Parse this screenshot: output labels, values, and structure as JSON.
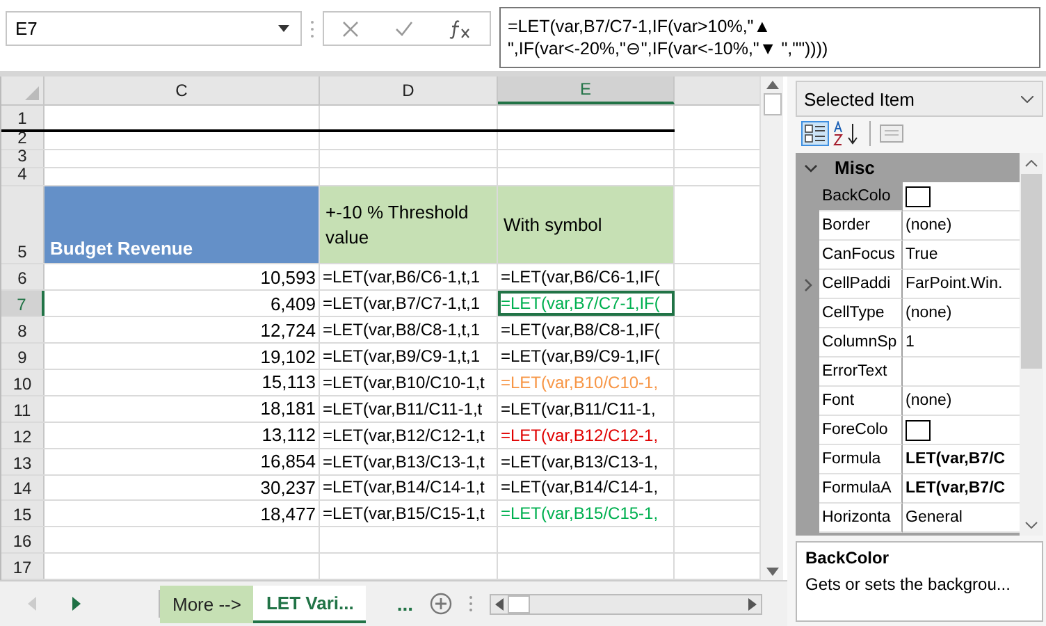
{
  "name_box": {
    "value": "E7"
  },
  "formula_bar": {
    "formula": "=LET(var,B7/C7-1,IF(var>10%,\"▲  \",IF(var<-20%,\"⊖\",IF(var<-10%,\"▼  \",\"\"))))"
  },
  "sheet": {
    "columns": [
      {
        "label": "C",
        "selected": false
      },
      {
        "label": "D",
        "selected": false
      },
      {
        "label": "E",
        "selected": true
      }
    ],
    "rows": [
      {
        "label": "1",
        "kind": "blank",
        "selected": false
      },
      {
        "label": "2",
        "kind": "spacer",
        "selected": false
      },
      {
        "label": "3",
        "kind": "spacer",
        "selected": false
      },
      {
        "label": "4",
        "kind": "spacer",
        "selected": false
      },
      {
        "label": "5",
        "kind": "header",
        "selected": false,
        "cells": [
          {
            "text": "Budget Revenue",
            "color": "#6490c8"
          },
          {
            "text": "+-10 % Threshold value",
            "color": "#c6e0b4"
          },
          {
            "text": "With symbol",
            "color": "#c6e0b4"
          }
        ]
      },
      {
        "label": "6",
        "kind": "data",
        "selected": false,
        "revenue": "10,593",
        "threshold": "=LET(var,B6/C6-1,t,1",
        "symbol": "=LET(var,B6/C6-1,IF(",
        "color": "#000000"
      },
      {
        "label": "7",
        "kind": "data",
        "selected": true,
        "revenue": "6,409",
        "threshold": "=LET(var,B7/C7-1,t,1",
        "symbol": "=LET(var,B7/C7-1,IF(",
        "color": "#00b050"
      },
      {
        "label": "8",
        "kind": "data",
        "selected": false,
        "revenue": "12,724",
        "threshold": "=LET(var,B8/C8-1,t,1",
        "symbol": "=LET(var,B8/C8-1,IF(",
        "color": "#000000"
      },
      {
        "label": "9",
        "kind": "data",
        "selected": false,
        "revenue": "19,102",
        "threshold": "=LET(var,B9/C9-1,t,1",
        "symbol": "=LET(var,B9/C9-1,IF(",
        "color": "#000000"
      },
      {
        "label": "10",
        "kind": "data",
        "selected": false,
        "revenue": "15,113",
        "threshold": "=LET(var,B10/C10-1,t",
        "symbol": "=LET(var,B10/C10-1,",
        "color": "#f79646"
      },
      {
        "label": "11",
        "kind": "data",
        "selected": false,
        "revenue": "18,181",
        "threshold": "=LET(var,B11/C11-1,t",
        "symbol": "=LET(var,B11/C11-1,",
        "color": "#000000"
      },
      {
        "label": "12",
        "kind": "data",
        "selected": false,
        "revenue": "13,112",
        "threshold": "=LET(var,B12/C12-1,t",
        "symbol": "=LET(var,B12/C12-1,",
        "color": "#e00000"
      },
      {
        "label": "13",
        "kind": "data",
        "selected": false,
        "revenue": "16,854",
        "threshold": "=LET(var,B13/C13-1,t",
        "symbol": "=LET(var,B13/C13-1,",
        "color": "#000000"
      },
      {
        "label": "14",
        "kind": "data",
        "selected": false,
        "revenue": "30,237",
        "threshold": "=LET(var,B14/C14-1,t",
        "symbol": "=LET(var,B14/C14-1,",
        "color": "#000000"
      },
      {
        "label": "15",
        "kind": "data",
        "selected": false,
        "revenue": "18,477",
        "threshold": "=LET(var,B15/C15-1,t",
        "symbol": "=LET(var,B15/C15-1,",
        "color": "#00b050"
      },
      {
        "label": "16",
        "kind": "blank",
        "selected": false
      },
      {
        "label": "17",
        "kind": "blank",
        "selected": false
      }
    ]
  },
  "sheet_tabs": [
    {
      "label": "More -->",
      "selected": false
    },
    {
      "label": "LET Vari...",
      "selected": true
    }
  ],
  "sheet_tabs_more": "...",
  "properties": {
    "selector": "Selected Item",
    "category": "Misc",
    "items": [
      {
        "name": "BackColo",
        "kind": "swatch",
        "color": "#ffffff",
        "expandable": false,
        "selected": true
      },
      {
        "name": "Border",
        "kind": "text",
        "value": "(none)",
        "bold": false,
        "expandable": false,
        "selected": false
      },
      {
        "name": "CanFocus",
        "kind": "text",
        "value": "True",
        "bold": false,
        "expandable": false,
        "selected": false
      },
      {
        "name": "CellPaddi",
        "kind": "text",
        "value": "FarPoint.Win.",
        "bold": false,
        "expandable": true,
        "selected": false
      },
      {
        "name": "CellType",
        "kind": "text",
        "value": "(none)",
        "bold": false,
        "expandable": false,
        "selected": false
      },
      {
        "name": "ColumnSp",
        "kind": "text",
        "value": "1",
        "bold": false,
        "expandable": false,
        "selected": false
      },
      {
        "name": "ErrorText",
        "kind": "empty",
        "expandable": false,
        "selected": false
      },
      {
        "name": "Font",
        "kind": "text",
        "value": "(none)",
        "bold": false,
        "expandable": false,
        "selected": false
      },
      {
        "name": "ForeColo",
        "kind": "swatch",
        "color": "#ffffff",
        "expandable": false,
        "selected": false
      },
      {
        "name": "Formula",
        "kind": "text",
        "value": "LET(var,B7/C",
        "bold": true,
        "expandable": false,
        "selected": false
      },
      {
        "name": "FormulaA",
        "kind": "text",
        "value": "LET(var,B7/C",
        "bold": true,
        "expandable": false,
        "selected": false
      },
      {
        "name": "Horizonta",
        "kind": "text",
        "value": "General",
        "bold": false,
        "expandable": false,
        "selected": false
      }
    ],
    "description": {
      "title": "BackColor",
      "text": "Gets or sets the backgrou..."
    }
  }
}
